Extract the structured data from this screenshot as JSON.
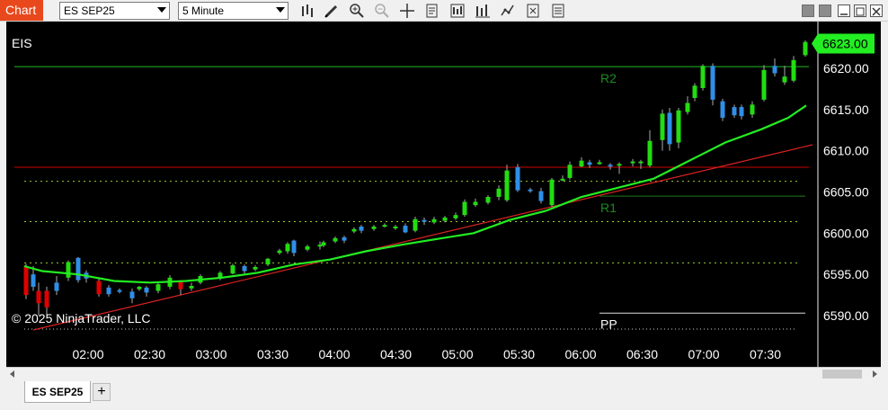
{
  "window": {
    "title": "Chart"
  },
  "toolbar": {
    "instrument": "ES SEP25",
    "interval": "5 Minute",
    "tools": [
      "bar-type-icon",
      "pencil-icon",
      "zoom-in-icon",
      "zoom-out-icon",
      "crosshair-icon",
      "data-box-icon",
      "strategies-icon",
      "indicators-icon",
      "strategy-analyzer-icon",
      "properties-icon",
      "template-icon"
    ]
  },
  "chart": {
    "instrument_label": "EIS",
    "copyright": "© 2025 NinjaTrader, LLC",
    "current_price": "6623.00",
    "y_ticks": [
      "6620.00",
      "6615.00",
      "6610.00",
      "6605.00",
      "6600.00",
      "6595.00",
      "6590.00"
    ],
    "y_values": [
      6620,
      6615,
      6610,
      6605,
      6600,
      6595,
      6590
    ],
    "x_ticks": [
      "02:00",
      "02:30",
      "03:00",
      "03:30",
      "04:00",
      "04:30",
      "05:00",
      "05:30",
      "06:00",
      "06:30",
      "07:00",
      "07:30"
    ],
    "pivot_labels": {
      "r2": "R2",
      "r1": "R1",
      "pp": "PP"
    },
    "levels": {
      "r2": 6620.2,
      "r1": 6604.5,
      "pp": 6590.3,
      "red_line": 6608.0
    },
    "colors": {
      "up": "#22dd11",
      "down": "#2f8fe8",
      "down_alt": "#e00000",
      "ma": "#22ee22",
      "price_tag": "#22ee22"
    }
  },
  "tabs": {
    "instrument_tab": "ES SEP25",
    "add_label": "+"
  }
}
